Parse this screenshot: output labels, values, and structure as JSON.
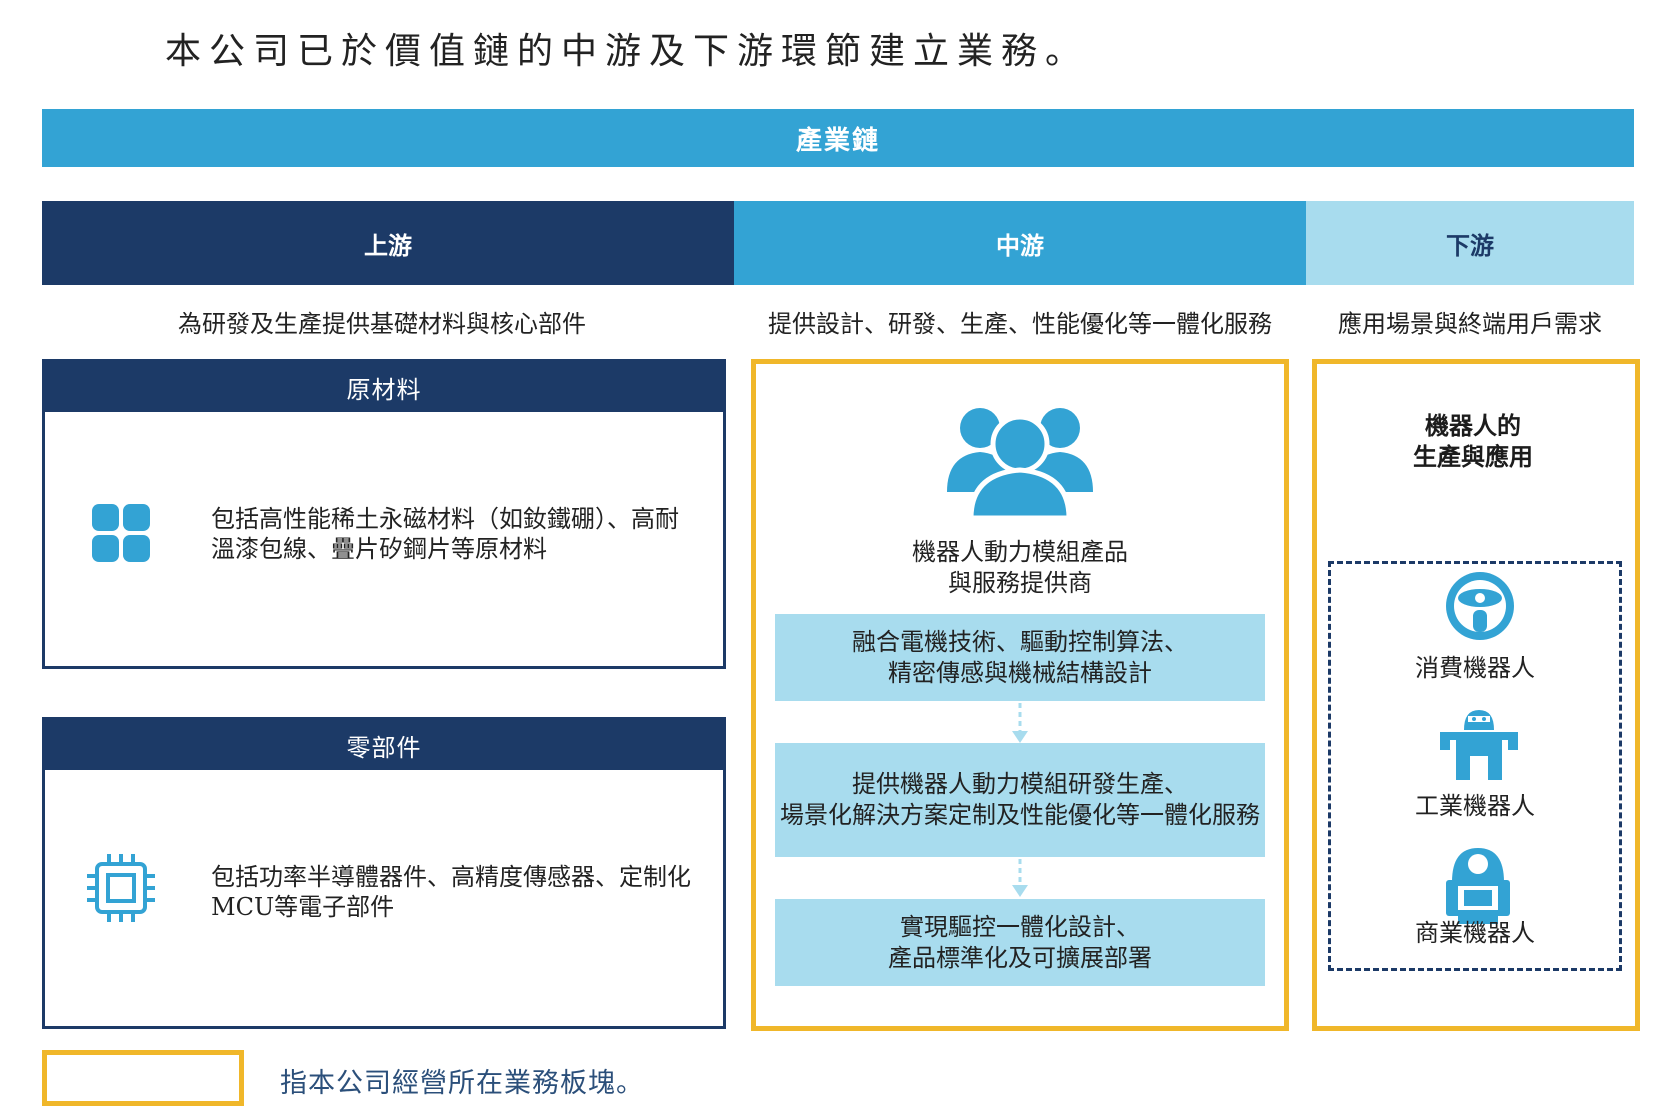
{
  "intro_text": "本公司已於價值鏈的中游及下游環節建立業務。",
  "chain_title": "產業鏈",
  "stages": {
    "upstream": "上游",
    "midstream": "中游",
    "downstream": "下游"
  },
  "stage_desc": {
    "upstream": "為研發及生產提供基礎材料與核心部件",
    "midstream": "提供設計、研發、生產、性能優化等一體化服務",
    "downstream": "應用場景與終端用戶需求"
  },
  "upstream_cards": [
    {
      "title": "原材料",
      "icon": "grid-blocks-icon",
      "text": "包括高性能稀土永磁材料（如釹鐵硼）、高耐溫漆包線、疊片矽鋼片等原材料"
    },
    {
      "title": "零部件",
      "icon": "chip-icon",
      "text": "包括功率半導體器件、高精度傳感器、定制化MCU等電子部件"
    }
  ],
  "midstream": {
    "icon": "people-group-icon",
    "provider_line1": "機器人動力模組產品",
    "provider_line2": "與服務提供商",
    "steps": [
      {
        "line1": "融合電機技術、驅動控制算法、",
        "line2": "精密傳感與機械結構設計"
      },
      {
        "line1": "提供機器人動力模組研發生產、",
        "line2": "場景化解決方案定制及性能優化等一體化服務"
      },
      {
        "line1": "實現驅控一體化設計、",
        "line2": "產品標準化及可擴展部署"
      }
    ]
  },
  "downstream": {
    "title_line1": "機器人的",
    "title_line2": "生產與應用",
    "robots": [
      {
        "label": "消費機器人",
        "icon": "consumer-robot-icon"
      },
      {
        "label": "工業機器人",
        "icon": "industrial-robot-icon"
      },
      {
        "label": "商業機器人",
        "icon": "commercial-robot-icon"
      }
    ]
  },
  "legend_text": "指本公司經營所在業務板塊。",
  "colors": {
    "navy": "#1c3a67",
    "blue": "#33a3d4",
    "light_blue": "#a8dcee",
    "gold": "#f0b72a"
  }
}
